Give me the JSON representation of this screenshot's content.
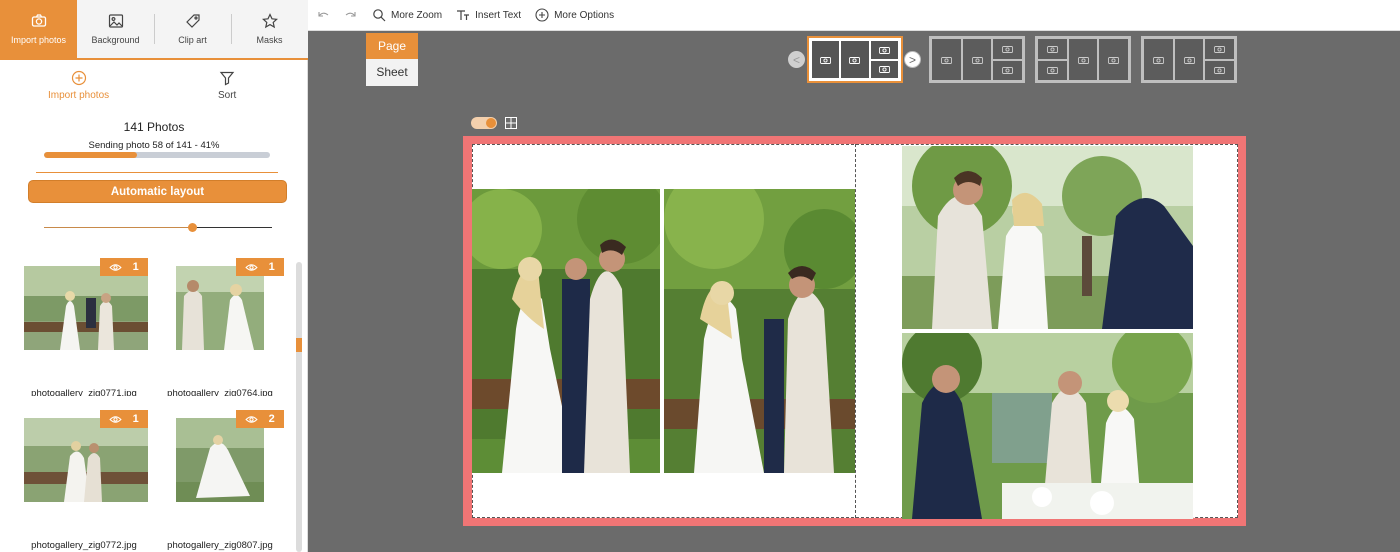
{
  "tabs": [
    {
      "label": "Import photos",
      "icon": "camera-icon"
    },
    {
      "label": "Background",
      "icon": "image-icon"
    },
    {
      "label": "Clip art",
      "icon": "tag-icon"
    },
    {
      "label": "Masks",
      "icon": "star-icon"
    }
  ],
  "actions": {
    "import_label": "Import photos",
    "sort_label": "Sort"
  },
  "status": {
    "photo_count": "141 Photos",
    "sending_text": "Sending photo 58 of 141 - 41%",
    "progress_fraction": 0.41
  },
  "auto_layout_label": "Automatic layout",
  "layout_slider_fraction": 0.65,
  "thumbnails": [
    {
      "name": "photogallery_zig0771.jpg",
      "count": "1"
    },
    {
      "name": "photogallery_zig0764.jpg",
      "count": "1"
    },
    {
      "name": "photogallery_zig0772.jpg",
      "count": "1"
    },
    {
      "name": "photogallery_zig0807.jpg",
      "count": "2"
    }
  ],
  "toolbar": {
    "zoom_label": "More Zoom",
    "text_label": "Insert Text",
    "options_label": "More Options"
  },
  "view_toggle": {
    "page_label": "Page",
    "sheet_label": "Sheet",
    "selected": "Page"
  },
  "strip": {
    "prev_label": "<",
    "next_label": ">"
  },
  "colors": {
    "accent": "#e8903a",
    "bleed_red": "#f07575",
    "workspace": "#6b6b6b"
  }
}
